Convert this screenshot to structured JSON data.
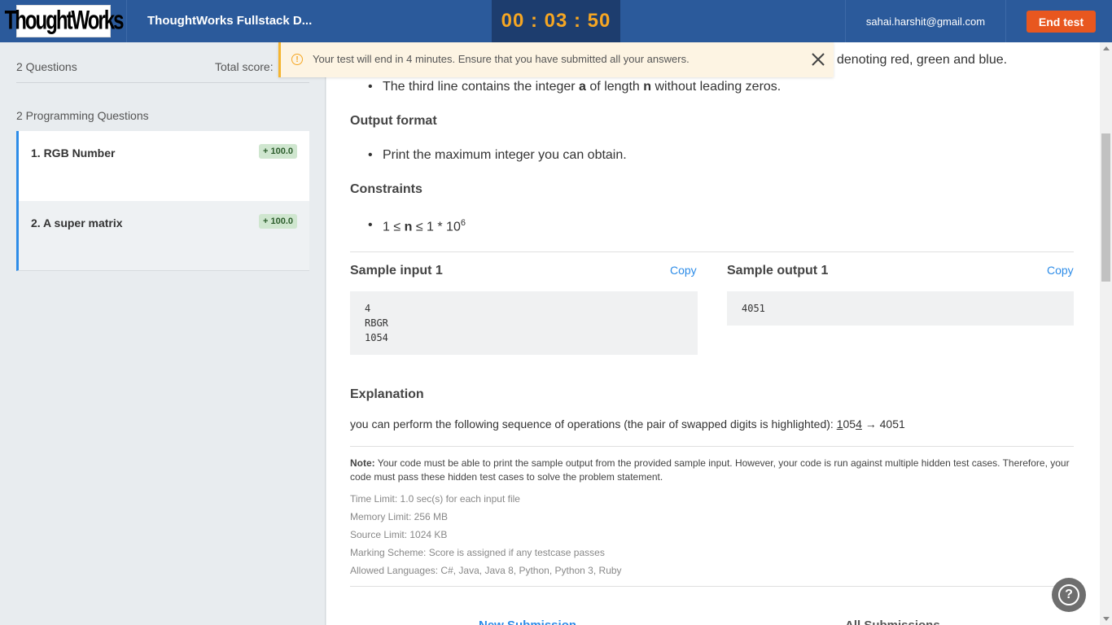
{
  "header": {
    "logo": "ThoughtWorks",
    "test_title": "ThoughtWorks Fullstack D...",
    "timer": "00 : 03 : 50",
    "email": "sahai.harshit@gmail.com",
    "end_test_label": "End test"
  },
  "sidebar": {
    "question_count": "2 Questions",
    "total_score_label": "Total score:",
    "section_title": "2 Programming Questions",
    "questions": [
      {
        "title": "1. RGB Number",
        "score": "+ 100.0",
        "active": true
      },
      {
        "title": "2. A super matrix",
        "score": "+ 100.0",
        "active": false
      }
    ]
  },
  "banner": {
    "message": "Your test will end in 4 minutes. Ensure that you have submitted all your answers."
  },
  "problem": {
    "partial_line": "denoting red, green and blue.",
    "input_bullet_prefix": "The third line contains the integer",
    "input_bullet_var_a": "a",
    "input_bullet_mid": "of length",
    "input_bullet_var_n": "n",
    "input_bullet_suffix": "without leading zeros.",
    "output_heading": "Output format",
    "output_bullet": "Print the maximum integer you can obtain.",
    "constraints_heading": "Constraints",
    "constraint_left": "1 ≤",
    "constraint_var": "n",
    "constraint_right": "≤ 1 * 10",
    "constraint_exp": "6",
    "sample_input_heading": "Sample input 1",
    "sample_output_heading": "Sample output 1",
    "copy_label": "Copy",
    "sample_input_lines": [
      "4",
      "RBGR",
      "1054"
    ],
    "sample_output_lines": [
      "4051"
    ],
    "explanation_heading": "Explanation",
    "explanation_text": "you can perform the following sequence of operations (the pair of swapped digits is highlighted):",
    "explanation_d1": "1",
    "explanation_d2": "05",
    "explanation_d3": "4",
    "explanation_arrow": "→ 4051",
    "note_label": "Note:",
    "note_text": "Your code must be able to print the sample output from the provided sample input. However, your code is run against multiple hidden test cases. Therefore, your code must pass these hidden test cases to solve the problem statement.",
    "time_limit": "Time Limit: 1.0 sec(s) for each input file",
    "memory_limit": "Memory Limit: 256 MB",
    "source_limit": "Source Limit: 1024 KB",
    "marking_scheme": "Marking Scheme: Score is assigned if any testcase passes",
    "allowed_languages": "Allowed Languages: C#, Java, Java 8, Python, Python 3, Ruby"
  },
  "tabs": {
    "new_submission": "New Submission",
    "all_submissions": "All Submissions"
  },
  "colors": {
    "header_bg": "#2b5a9b",
    "timer_bg": "#1d3d6e",
    "timer_text": "#f5a623",
    "end_button": "#e8571f",
    "accent": "#2d8ce8",
    "badge_bg": "#cfe6cf",
    "banner_bg": "#fdf4e3"
  },
  "icons": {
    "warning": "warning-circle-icon",
    "close": "close-icon",
    "help": "help-question-icon"
  }
}
